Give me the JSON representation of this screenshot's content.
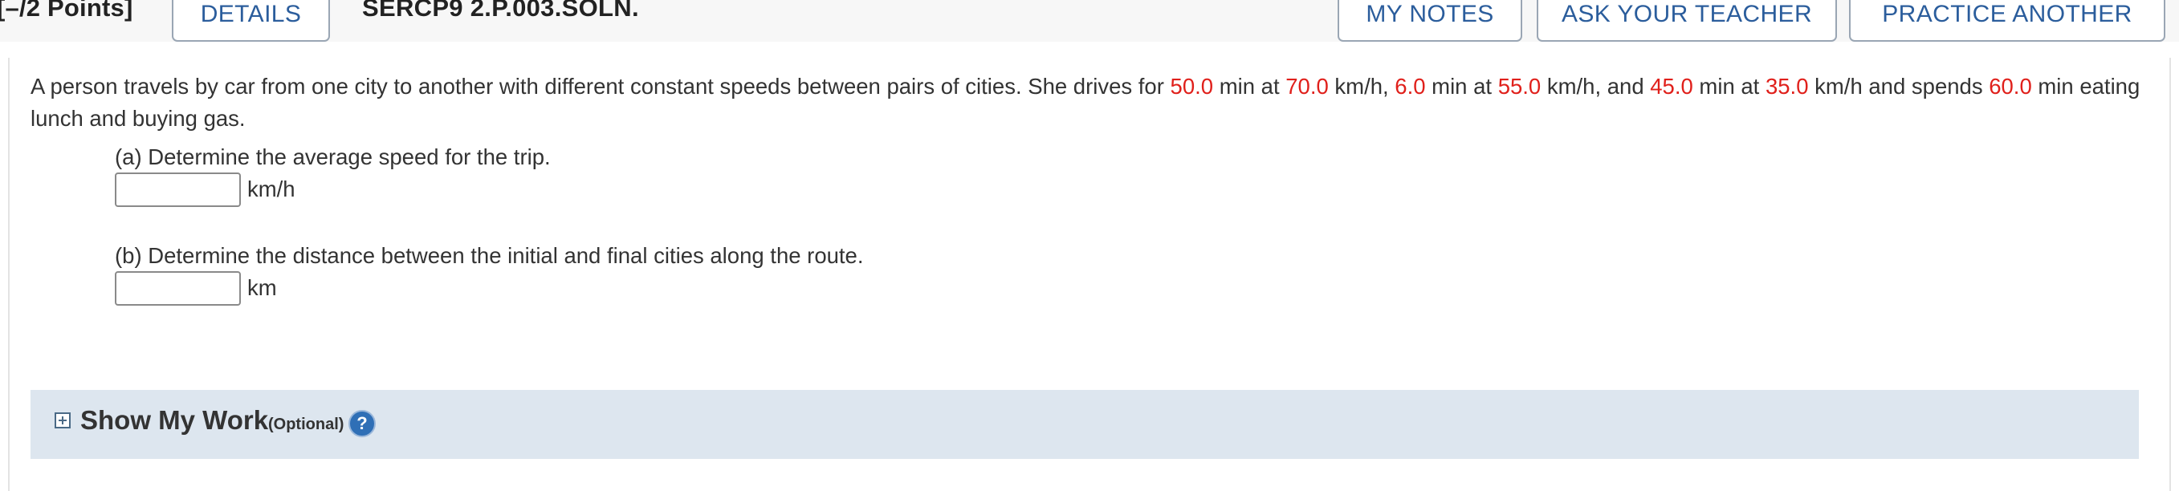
{
  "header": {
    "points": "[–/2 Points]",
    "details_label": "DETAILS",
    "question_id": "SERCP9 2.P.003.SOLN.",
    "my_notes_label": "MY NOTES",
    "ask_teacher_label": "ASK YOUR TEACHER",
    "practice_label": "PRACTICE ANOTHER"
  },
  "question": {
    "t1": "A person travels by car from one city to another with different constant speeds between pairs of cities. She drives for ",
    "v1": "50.0",
    "t2": " min at ",
    "v2": "70.0",
    "t3": " km/h, ",
    "v3": "6.0",
    "t4": " min at ",
    "v4": "55.0",
    "t5": " km/h, and ",
    "v5": "45.0",
    "t6": " min at ",
    "v6": "35.0",
    "t7": " km/h and spends ",
    "v7": "60.0",
    "t8": " min eating lunch and buying gas."
  },
  "parts": [
    {
      "label": "(a) Determine the average speed for the trip.",
      "value": "",
      "unit": "km/h"
    },
    {
      "label": "(b) Determine the distance between the initial and final cities along the route.",
      "value": "",
      "unit": "km"
    }
  ],
  "show_my_work": {
    "title": "Show My Work",
    "optional": "(Optional)",
    "help_glyph": "?",
    "expand_icon": "plus-box-icon",
    "help_icon": "question-circle-icon"
  },
  "colors": {
    "given_value": "#e0201b",
    "button_text": "#2b5d9c",
    "panel_bg": "#dde6ef"
  }
}
